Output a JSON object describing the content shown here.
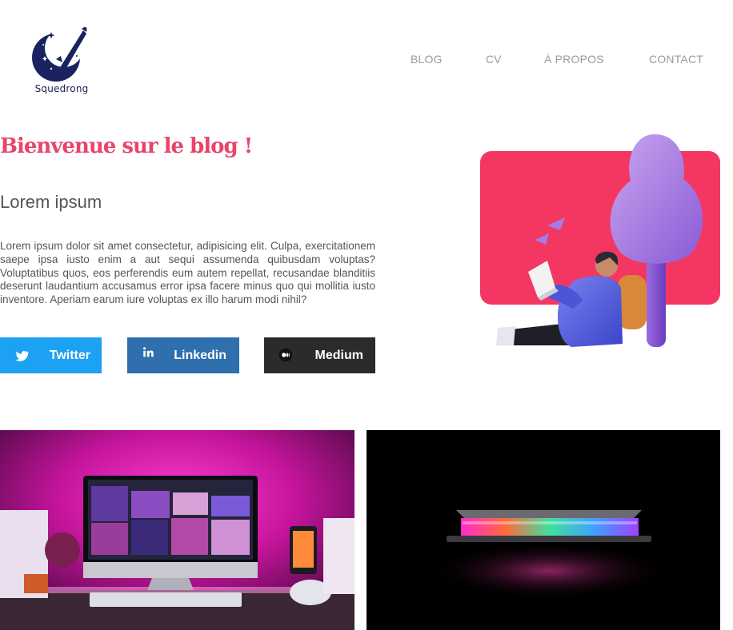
{
  "header": {
    "logo_text": "Squedrong",
    "nav": [
      {
        "label": "BLOG"
      },
      {
        "label": "CV"
      },
      {
        "label": "À PROPOS"
      },
      {
        "label": "CONTACT"
      }
    ]
  },
  "hero": {
    "title": "Bienvenue sur le blog !",
    "subtitle": "Lorem ipsum",
    "body": "Lorem ipsum dolor sit amet consectetur, adipisicing elit. Culpa, exercitationem saepe ipsa iusto enim a aut sequi assumenda quibusdam voluptas? Voluptatibus quos, eos perferendis eum autem repellat, recusandae blanditiis deserunt laudantium accusamus error ipsa facere minus quo qui mollitia iusto inventore. Aperiam earum iure voluptas ex illo harum modi nihil?",
    "buttons": [
      {
        "label": "Twitter",
        "icon": "twitter-icon",
        "color": "#1da1f2"
      },
      {
        "label": "Linkedin",
        "icon": "linkedin-icon",
        "color": "#2f6fad"
      },
      {
        "label": "Medium",
        "icon": "medium-icon",
        "color": "#2b2b2b"
      }
    ]
  },
  "colors": {
    "accent": "#e8456a",
    "nav_text": "#9a9a9a",
    "body_text": "#555555"
  }
}
